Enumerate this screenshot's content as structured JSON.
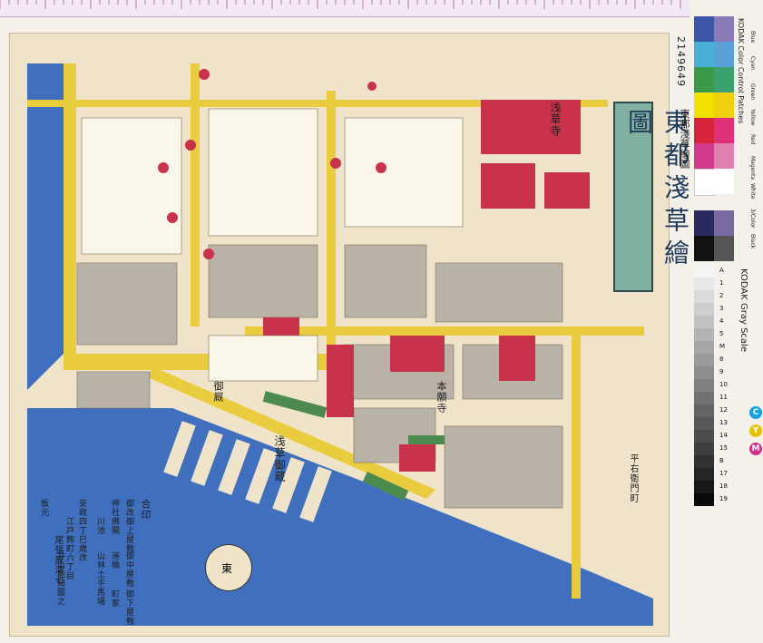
{
  "ruler": {
    "label": "ruler"
  },
  "map": {
    "title": "東都淺草繪圖",
    "catalog_no": "2149649",
    "catalog_title": "東都淺草繪圖",
    "labels": {
      "sensoji": "浅草寺",
      "kuramae": "浅草御蔵",
      "okura": "御厩",
      "honganji": "本願寺",
      "hirayama": "平右衛門町"
    },
    "legend": {
      "heading": "合印",
      "items": [
        "御改御上屋敷",
        "神社佛閣",
        "道橋",
        "町家",
        "川池",
        "山林土手馬場",
        "御中屋敷",
        "御下屋敷"
      ],
      "publisher_lines": [
        "安政四丁巳歳改",
        "江戸麹町六丁目",
        "尾張屋清七",
        "板元"
      ],
      "author": "井山能知圖之"
    },
    "compass": {
      "label": "東"
    }
  },
  "colors": {
    "water": "#3f6fbd",
    "road": "#e9cd3f",
    "temple": "#c8324a",
    "town": "#b9b2a6",
    "green": "#4d8a4f",
    "paper": "#efe4c9"
  },
  "color_patch": {
    "brand": "KODAK Color Control Patches",
    "labels": [
      "Blue",
      "Cyan",
      "Green",
      "Yellow",
      "Red",
      "Magenta",
      "White",
      "3/Color",
      "Black"
    ],
    "colors": [
      "#3b56a8",
      "#4ab0d8",
      "#3a9a4a",
      "#f2e100",
      "#d6243a",
      "#d23a8c",
      "#ffffff",
      "#5a4a70",
      "#111111"
    ]
  },
  "gray_scale": {
    "brand": "KODAK Gray Scale",
    "steps": [
      "A",
      "1",
      "2",
      "3",
      "4",
      "5",
      "M",
      "8",
      "9",
      "10",
      "11",
      "12",
      "13",
      "14",
      "15",
      "B",
      "17",
      "18",
      "19"
    ],
    "cmy": [
      "C",
      "Y",
      "M"
    ]
  }
}
